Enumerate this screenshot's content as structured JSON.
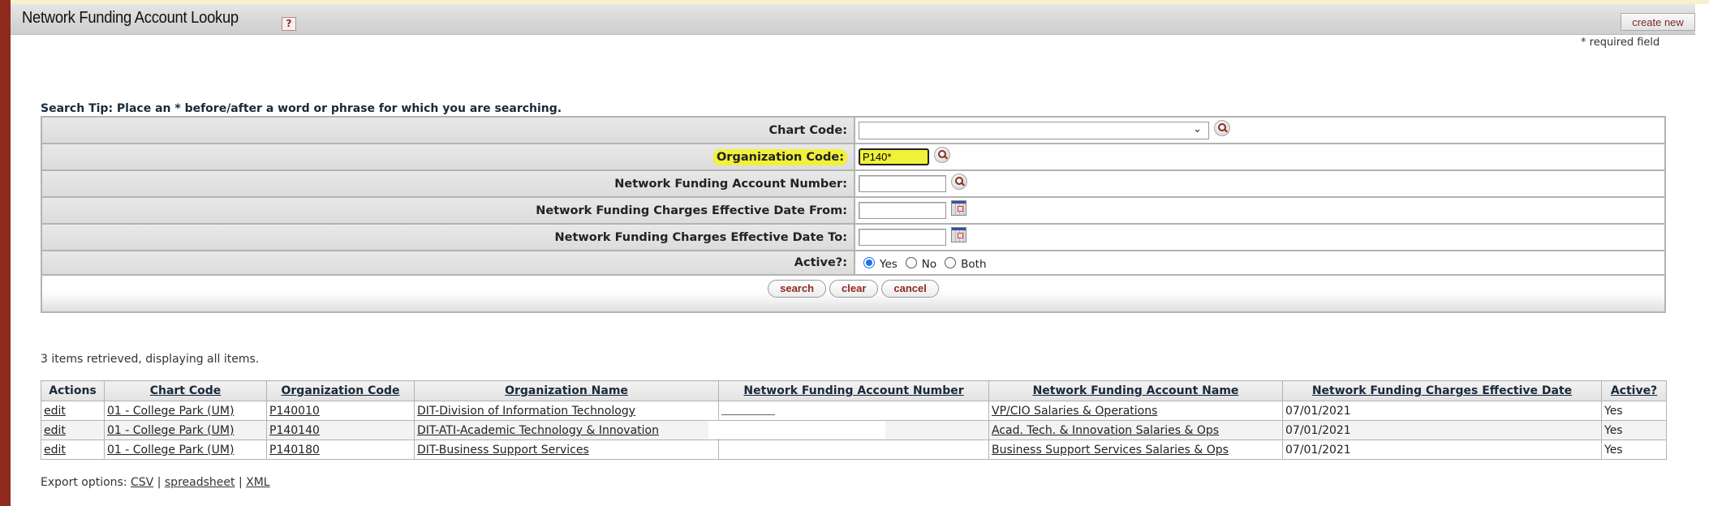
{
  "header": {
    "title": "Network Funding Account Lookup",
    "help_icon": "help-icon",
    "create_new_label": "create new",
    "required_note": "* required field"
  },
  "search": {
    "tip": "Search Tip: Place an * before/after a word or phrase for which you are searching.",
    "fields": {
      "chart_code": {
        "label": "Chart Code:",
        "value": "",
        "icon": "lookup-icon"
      },
      "organization_code": {
        "label": "Organization Code:",
        "value": "P140*",
        "icon": "lookup-icon",
        "highlighted": true
      },
      "account_number": {
        "label": "Network Funding Account Number:",
        "value": "",
        "icon": "lookup-icon"
      },
      "date_from": {
        "label": "Network Funding Charges Effective Date From:",
        "value": "",
        "icon": "calendar-icon"
      },
      "date_to": {
        "label": "Network Funding Charges Effective Date To:",
        "value": "",
        "icon": "calendar-icon"
      },
      "active": {
        "label": "Active?:",
        "options": [
          "Yes",
          "No",
          "Both"
        ],
        "selected": "Yes"
      }
    },
    "buttons": {
      "search": "search",
      "clear": "clear",
      "cancel": "cancel"
    }
  },
  "results": {
    "summary": "3 items retrieved, displaying all items.",
    "columns": [
      "Actions",
      "Chart Code",
      "Organization Code",
      "Organization Name",
      "Network Funding Account Number",
      "Network Funding Account Name",
      "Network Funding Charges Effective Date",
      "Active?"
    ],
    "rows": [
      {
        "action": "edit",
        "chart_code": "01 - College Park (UM)",
        "org_code": "P140010",
        "org_name": "DIT-Division of Information Technology",
        "account_number": "",
        "account_name": "VP/CIO Salaries & Operations",
        "effective_date": "07/01/2021",
        "active": "Yes"
      },
      {
        "action": "edit",
        "chart_code": "01 - College Park (UM)",
        "org_code": "P140140",
        "org_name": "DIT-ATI-Academic Technology & Innovation",
        "account_number": "",
        "account_name": "Acad. Tech. & Innovation Salaries & Ops",
        "effective_date": "07/01/2021",
        "active": "Yes"
      },
      {
        "action": "edit",
        "chart_code": "01 - College Park (UM)",
        "org_code": "P140180",
        "org_name": "DIT-Business Support Services",
        "account_number": "",
        "account_name": "Business Support Services Salaries & Ops",
        "effective_date": "07/01/2021",
        "active": "Yes"
      }
    ]
  },
  "export": {
    "label": "Export options:",
    "options": [
      "CSV",
      "spreadsheet",
      "XML"
    ],
    "separator": "|"
  },
  "colors": {
    "brand_red": "#8e2a1e",
    "highlight_yellow": "#f1f13a",
    "radio_blue": "#1a73e8"
  }
}
